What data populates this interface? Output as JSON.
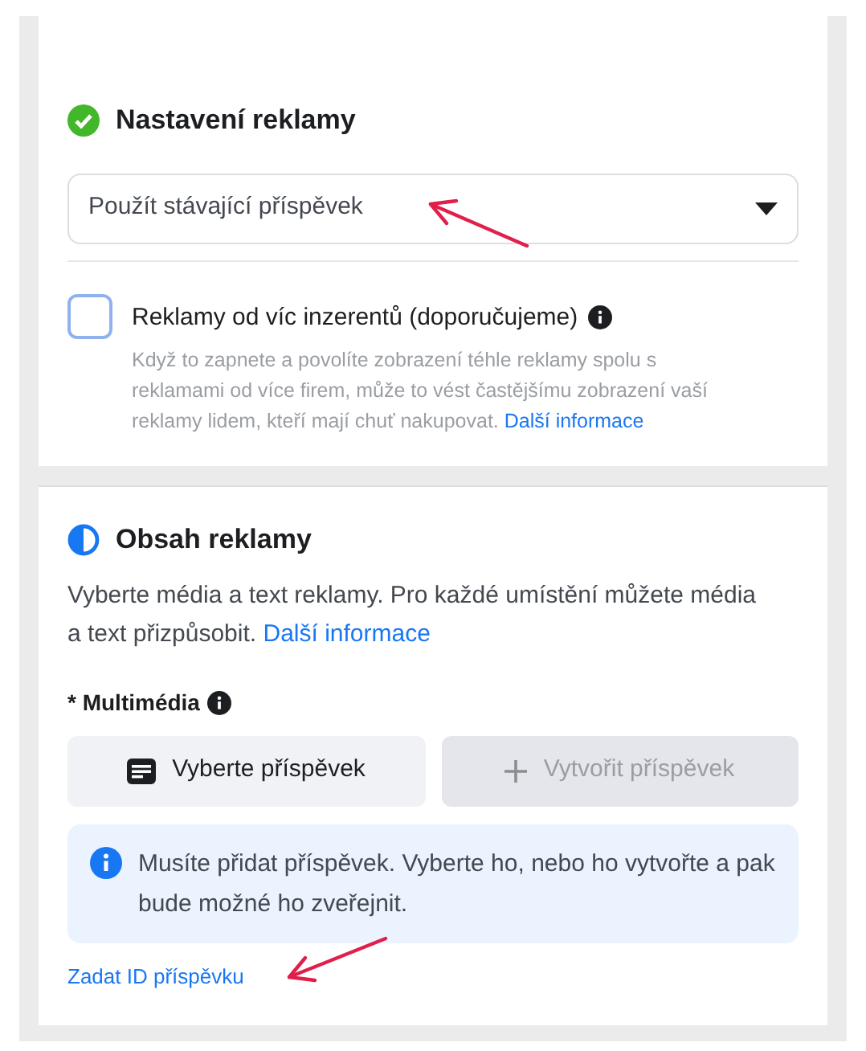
{
  "ad_settings": {
    "title": "Nastavení reklamy",
    "complete": true,
    "dropdown": {
      "value": "Použít stávající příspěvek"
    },
    "checkbox": {
      "label": "Reklamy od víc inzerentů (doporučujeme)",
      "checked": false,
      "description": "Když to zapnete a povolíte zobrazení téhle reklamy spolu s reklamami od více firem, může to vést častějšímu zobrazení vaší reklamy lidem, kteří mají chuť nakupovat.",
      "link": "Další informace"
    }
  },
  "ad_content": {
    "title": "Obsah reklamy",
    "complete": false,
    "description": "Vyberte média a text reklamy. Pro každé umístění můžete média a text přizpůsobit.",
    "link": "Další informace",
    "media_label": "* Multimédia",
    "buttons": [
      {
        "kind": "select",
        "label": "Vyberte příspěvek",
        "disabled": false
      },
      {
        "kind": "create",
        "label": "Vytvořit příspěvek",
        "disabled": true
      }
    ],
    "notice": "Musíte přidat příspěvek. Vyberte ho, nebo ho vytvořte a pak bude možné ho zveřejnit.",
    "id_link": "Zadat ID příspěvku"
  }
}
